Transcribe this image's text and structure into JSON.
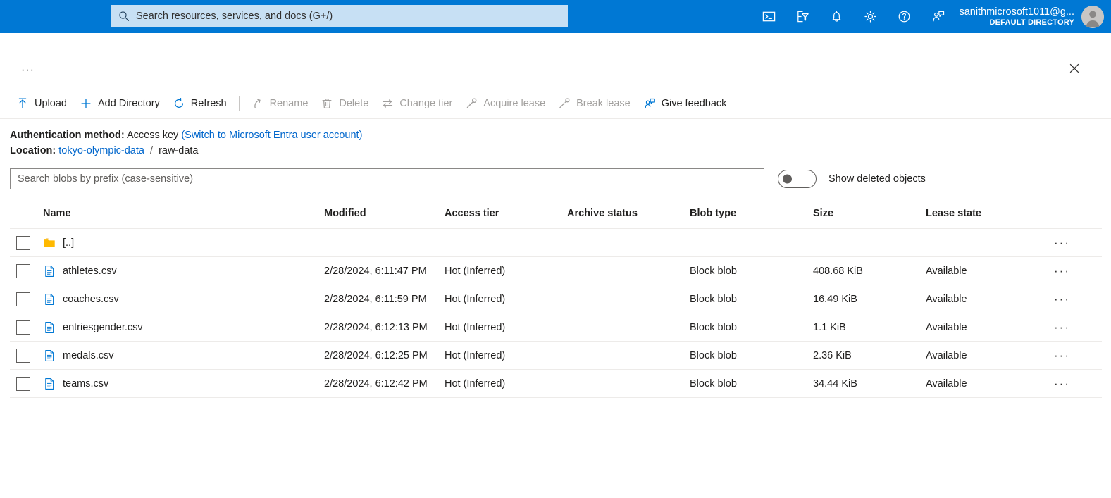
{
  "topbar": {
    "search_placeholder": "Search resources, services, and docs (G+/)",
    "search_icon": "search-icon",
    "icons": [
      {
        "name": "cloud-shell-icon",
        "title": "Cloud Shell"
      },
      {
        "name": "directories-subscriptions-icon",
        "title": "Directories + subscriptions"
      },
      {
        "name": "notifications-bell-icon",
        "title": "Notifications"
      },
      {
        "name": "settings-gear-icon",
        "title": "Settings"
      },
      {
        "name": "help-question-icon",
        "title": "Help"
      },
      {
        "name": "feedback-person-icon",
        "title": "Feedback"
      }
    ],
    "account_name": "sanithmicrosoft1011@g...",
    "account_directory": "DEFAULT DIRECTORY",
    "accent_color": "#0078d4",
    "search_field_color": "#c7e0f4"
  },
  "blade": {
    "breadcrumb_more": "···",
    "close_label": "Close"
  },
  "toolbar": {
    "commands": [
      {
        "label": "Upload",
        "icon": "upload-arrow-icon",
        "disabled": false
      },
      {
        "label": "Add Directory",
        "icon": "plus-icon",
        "disabled": false
      },
      {
        "label": "Refresh",
        "icon": "refresh-circle-icon",
        "disabled": false
      },
      {
        "label": "Rename",
        "icon": "rename-arc-icon",
        "disabled": true
      },
      {
        "label": "Delete",
        "icon": "trash-icon",
        "disabled": true
      },
      {
        "label": "Change tier",
        "icon": "swap-arrows-icon",
        "disabled": true
      },
      {
        "label": "Acquire lease",
        "icon": "lease-key-icon",
        "disabled": true
      },
      {
        "label": "Break lease",
        "icon": "break-lease-icon",
        "disabled": true
      },
      {
        "label": "Give feedback",
        "icon": "feedback-person-icon",
        "disabled": false
      }
    ]
  },
  "info": {
    "auth_label": "Authentication method:",
    "auth_value": "Access key",
    "auth_switch_link": "(Switch to Microsoft Entra user account)",
    "location_label": "Location:",
    "location_container": "tokyo-olympic-data",
    "location_separator": "/",
    "location_folder": "raw-data",
    "link_color": "#0066cc"
  },
  "filter": {
    "search_placeholder": "Search blobs by prefix (case-sensitive)",
    "search_value": "",
    "toggle_label": "Show deleted objects",
    "toggle_state": "off"
  },
  "table": {
    "columns": [
      "Name",
      "Modified",
      "Access tier",
      "Archive status",
      "Blob type",
      "Size",
      "Lease state"
    ],
    "rows": [
      {
        "icon": "folder-icon",
        "name": "[..]",
        "modified": "",
        "access_tier": "",
        "archive_status": "",
        "blob_type": "",
        "size": "",
        "lease_state": "",
        "menu": "···"
      },
      {
        "icon": "file-csv-icon",
        "name": "athletes.csv",
        "modified": "2/28/2024, 6:11:47 PM",
        "access_tier": "Hot (Inferred)",
        "archive_status": "",
        "blob_type": "Block blob",
        "size": "408.68 KiB",
        "lease_state": "Available",
        "menu": "···"
      },
      {
        "icon": "file-csv-icon",
        "name": "coaches.csv",
        "modified": "2/28/2024, 6:11:59 PM",
        "access_tier": "Hot (Inferred)",
        "archive_status": "",
        "blob_type": "Block blob",
        "size": "16.49 KiB",
        "lease_state": "Available",
        "menu": "···"
      },
      {
        "icon": "file-csv-icon",
        "name": "entriesgender.csv",
        "modified": "2/28/2024, 6:12:13 PM",
        "access_tier": "Hot (Inferred)",
        "archive_status": "",
        "blob_type": "Block blob",
        "size": "1.1 KiB",
        "lease_state": "Available",
        "menu": "···"
      },
      {
        "icon": "file-csv-icon",
        "name": "medals.csv",
        "modified": "2/28/2024, 6:12:25 PM",
        "access_tier": "Hot (Inferred)",
        "archive_status": "",
        "blob_type": "Block blob",
        "size": "2.36 KiB",
        "lease_state": "Available",
        "menu": "···"
      },
      {
        "icon": "file-csv-icon",
        "name": "teams.csv",
        "modified": "2/28/2024, 6:12:42 PM",
        "access_tier": "Hot (Inferred)",
        "archive_status": "",
        "blob_type": "Block blob",
        "size": "34.44 KiB",
        "lease_state": "Available",
        "menu": "···"
      }
    ]
  }
}
